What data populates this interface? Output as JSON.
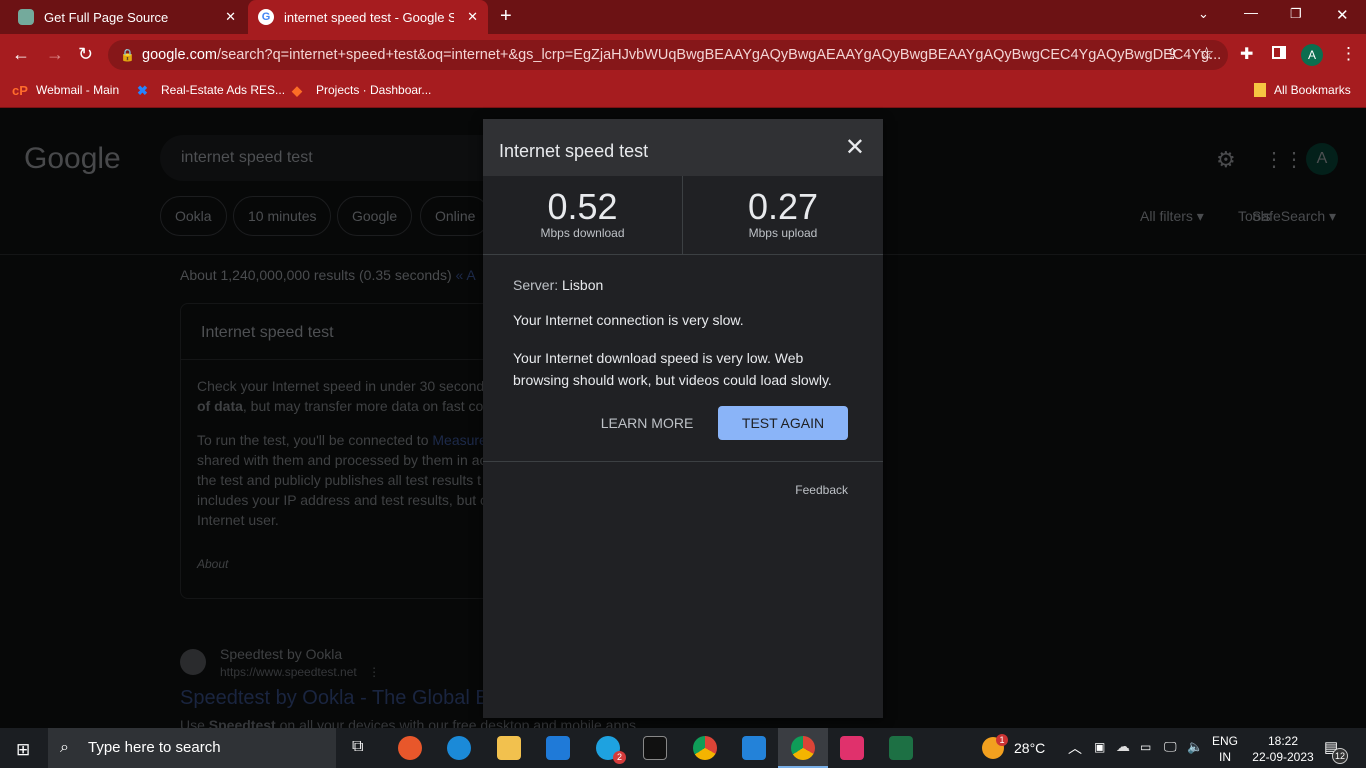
{
  "browser": {
    "tabs": [
      {
        "title": "Get Full Page Source",
        "active": false
      },
      {
        "title": "internet speed test - Google Sea",
        "active": true
      }
    ],
    "url_host": "google.com",
    "url_rest": "/search?q=internet+speed+test&oq=internet+&gs_lcrp=EgZjaHJvbWUqBwgBEAAYgAQyBwgAEAAYgAQyBwgBEAAYgAQyBwgCEC4YgAQyBwgDEC4Yg...",
    "bookmarks": [
      "Webmail - Main",
      "Real-Estate Ads RES...",
      "Projects · Dashboar..."
    ],
    "all_bookmarks": "All Bookmarks",
    "profile_initial": "A"
  },
  "google": {
    "logo": "Google",
    "query": "internet speed test",
    "chips": [
      "Ookla",
      "10 minutes",
      "Google",
      "Online"
    ],
    "all_filters": "All filters",
    "tools": "Tools",
    "safesearch": "SafeSearch",
    "result_stats": "About 1,240,000,000 results (0.35 seconds)",
    "result_stats_link": "« A",
    "card_title": "Internet speed test",
    "card_p1a": "Check your Internet speed in under 30 second",
    "card_p1b": "of data",
    "card_p1c": ", but may transfer more data on fast co",
    "card_p2a": "To run the test, you'll be connected to ",
    "card_p2link": "Measure",
    "card_p2_lines": [
      "shared with them and processed by them in ac",
      "the test and publicly publishes all test results t",
      "includes your IP address and test results, but c",
      "Internet user."
    ],
    "card_about": "About",
    "result_site": "Speedtest by Ookla",
    "result_url": "https://www.speedtest.net",
    "result_title": "Speedtest by Ookla - The Global B",
    "result_snippet_a": "Use ",
    "result_snippet_b": "Speedtest",
    "result_snippet_c": " on all your devices with our free desktop and mobile apps",
    "avatar": "A"
  },
  "dialog": {
    "title": "Internet speed test",
    "download_value": "0.52",
    "download_label": "Mbps download",
    "upload_value": "0.27",
    "upload_label": "Mbps upload",
    "server_label": "Server: ",
    "server": "Lisbon",
    "status": "Your Internet connection is very slow.",
    "detail_1": "Your Internet download speed is very low. Web",
    "detail_2": "browsing should work, but videos could load slowly.",
    "learn_more": "LEARN MORE",
    "test_again": "TEST AGAIN",
    "feedback": "Feedback",
    "accent": "#8ab4f8"
  },
  "taskbar": {
    "search_placeholder": "Type here to search",
    "weather": "28°C",
    "weather_badge": "1",
    "lang1": "ENG",
    "lang2": "IN",
    "time": "18:22",
    "date": "22-09-2023",
    "notifications": "12",
    "skype_badge": "2"
  }
}
